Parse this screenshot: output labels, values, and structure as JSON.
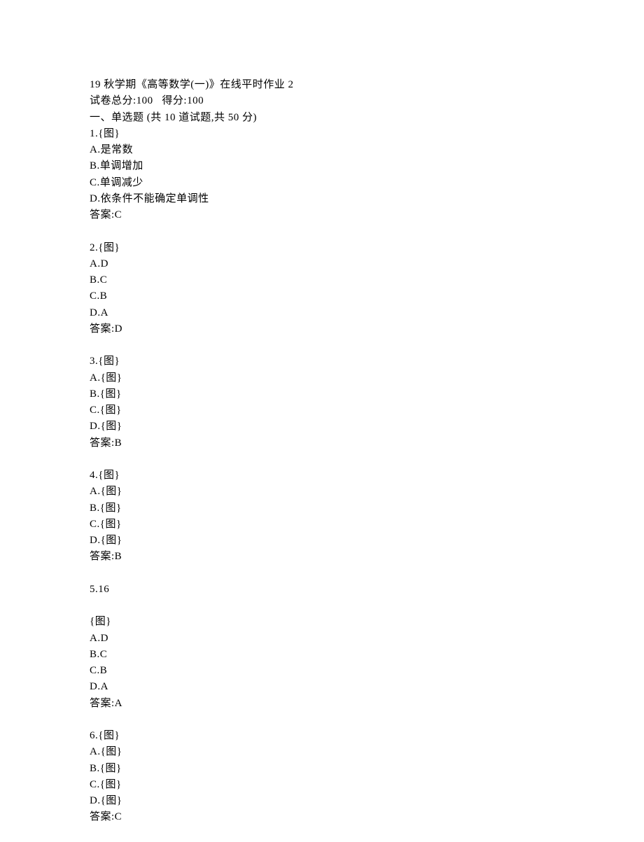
{
  "header": {
    "title": "19 秋学期《高等数学(一)》在线平时作业 2",
    "score_line": "试卷总分:100   得分:100",
    "section": "一、单选题 (共 10 道试题,共 50 分)"
  },
  "questions": [
    {
      "num": "1",
      "stem": "{图}",
      "options": [
        {
          "label": "A",
          "text": "是常数"
        },
        {
          "label": "B",
          "text": "单调增加"
        },
        {
          "label": "C",
          "text": "单调减少"
        },
        {
          "label": "D",
          "text": "依条件不能确定单调性"
        }
      ],
      "answer": "C"
    },
    {
      "num": "2",
      "stem": "{图}",
      "options": [
        {
          "label": "A",
          "text": "D"
        },
        {
          "label": "B",
          "text": "C"
        },
        {
          "label": "C",
          "text": "B"
        },
        {
          "label": "D",
          "text": "A"
        }
      ],
      "answer": "D"
    },
    {
      "num": "3",
      "stem": "{图}",
      "options": [
        {
          "label": "A",
          "text": "{图}"
        },
        {
          "label": "B",
          "text": "{图}"
        },
        {
          "label": "C",
          "text": "{图}"
        },
        {
          "label": "D",
          "text": "{图}"
        }
      ],
      "answer": "B"
    },
    {
      "num": "4",
      "stem": "{图}",
      "options": [
        {
          "label": "A",
          "text": "{图}"
        },
        {
          "label": "B",
          "text": "{图}"
        },
        {
          "label": "C",
          "text": "{图}"
        },
        {
          "label": "D",
          "text": "{图}"
        }
      ],
      "answer": "B"
    },
    {
      "num": "5",
      "stem": "16",
      "extra_lines": [
        "",
        "{图}"
      ],
      "options": [
        {
          "label": "A",
          "text": "D"
        },
        {
          "label": "B",
          "text": "C"
        },
        {
          "label": "C",
          "text": "B"
        },
        {
          "label": "D",
          "text": "A"
        }
      ],
      "answer": "A"
    },
    {
      "num": "6",
      "stem": "{图}",
      "options": [
        {
          "label": "A",
          "text": "{图}"
        },
        {
          "label": "B",
          "text": "{图}"
        },
        {
          "label": "C",
          "text": "{图}"
        },
        {
          "label": "D",
          "text": "{图}"
        }
      ],
      "answer": "C"
    }
  ],
  "labels": {
    "answer_prefix": "答案:"
  }
}
